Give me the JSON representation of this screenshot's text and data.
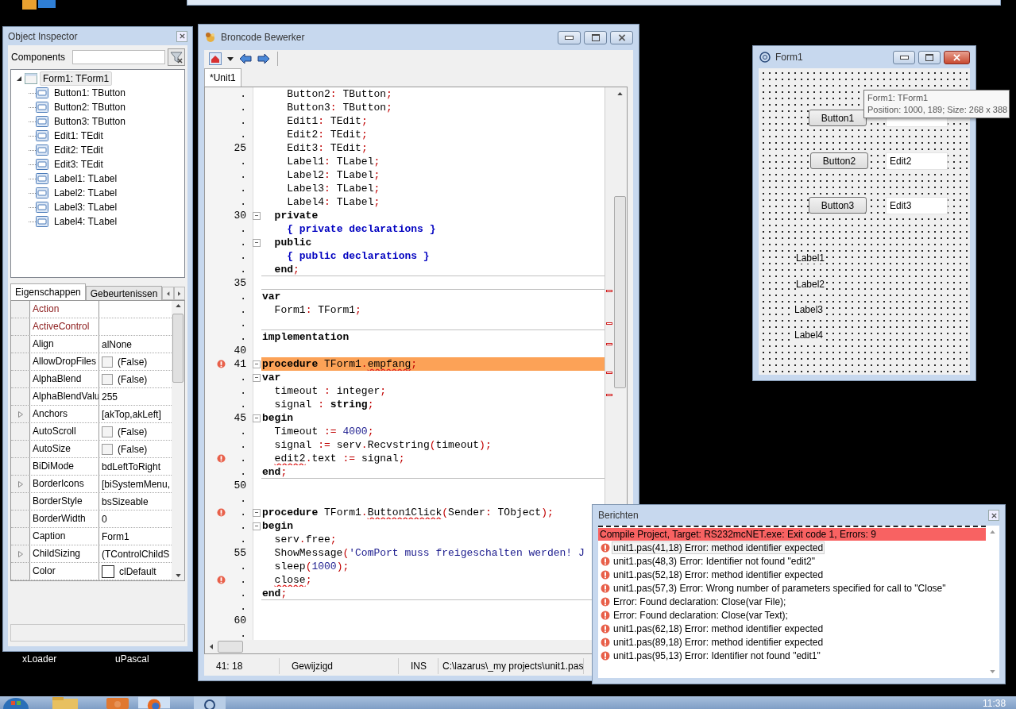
{
  "inspector": {
    "title": "Object Inspector",
    "components_label": "Components",
    "tree": [
      {
        "label": "Form1: TForm1",
        "selected": true,
        "expanded": true,
        "children": [
          {
            "label": "Button1: TButton",
            "selected": false
          },
          {
            "label": "Button2: TButton",
            "selected": false
          },
          {
            "label": "Button3: TButton",
            "selected": false
          },
          {
            "label": "Edit1: TEdit",
            "selected": false
          },
          {
            "label": "Edit2: TEdit",
            "selected": false
          },
          {
            "label": "Edit3: TEdit",
            "selected": false
          },
          {
            "label": "Label1: TLabel",
            "selected": false
          },
          {
            "label": "Label2: TLabel",
            "selected": false
          },
          {
            "label": "Label3: TLabel",
            "selected": false
          },
          {
            "label": "Label4: TLabel",
            "selected": false
          }
        ]
      }
    ],
    "tabs": [
      {
        "label": "Eigenschappen",
        "selected": true
      },
      {
        "label": "Gebeurtenissen",
        "selected": false
      }
    ],
    "properties": [
      {
        "name": "Action",
        "kind": "text",
        "reference": true,
        "expandable": false
      },
      {
        "name": "ActiveControl",
        "kind": "text",
        "reference": true,
        "expandable": false
      },
      {
        "name": "Align",
        "kind": "text",
        "value": "alNone",
        "reference": false,
        "expandable": false
      },
      {
        "name": "AllowDropFiles",
        "kind": "check",
        "checked": false,
        "value": "(False)",
        "reference": false,
        "expandable": false
      },
      {
        "name": "AlphaBlend",
        "kind": "check",
        "checked": false,
        "value": "(False)",
        "reference": false,
        "expandable": false
      },
      {
        "name": "AlphaBlendValu",
        "kind": "text",
        "value": "255",
        "reference": false,
        "expandable": false
      },
      {
        "name": "Anchors",
        "kind": "text",
        "value": "[akTop,akLeft]",
        "reference": false,
        "expandable": true
      },
      {
        "name": "AutoScroll",
        "kind": "check",
        "checked": false,
        "value": "(False)",
        "reference": false,
        "expandable": false
      },
      {
        "name": "AutoSize",
        "kind": "check",
        "checked": false,
        "value": "(False)",
        "reference": false,
        "expandable": false
      },
      {
        "name": "BiDiMode",
        "kind": "text",
        "value": "bdLeftToRight",
        "reference": false,
        "expandable": false
      },
      {
        "name": "BorderIcons",
        "kind": "text",
        "value": "[biSystemMenu,",
        "reference": false,
        "expandable": true
      },
      {
        "name": "BorderStyle",
        "kind": "text",
        "value": "bsSizeable",
        "reference": false,
        "expandable": false
      },
      {
        "name": "BorderWidth",
        "kind": "text",
        "value": "0",
        "reference": false,
        "expandable": false
      },
      {
        "name": "Caption",
        "kind": "text",
        "value": "Form1",
        "reference": false,
        "expandable": false
      },
      {
        "name": "ChildSizing",
        "kind": "text",
        "value": "(TControlChildS",
        "reference": false,
        "expandable": true
      },
      {
        "name": "Color",
        "kind": "color",
        "value": "clDefault",
        "reference": false,
        "expandable": false
      }
    ]
  },
  "editor": {
    "title": "Broncode Bewerker",
    "tabs": [
      {
        "label": "*Unit1",
        "selected": true
      }
    ],
    "lines": [
      {
        "gutter": ".",
        "error": false,
        "fold": false,
        "rule": false,
        "highlighted": false,
        "segments": [
          {
            "kind": "id",
            "text": "    Button2"
          },
          {
            "kind": "sym",
            "text": ":"
          },
          {
            "kind": "id",
            "text": " TButton"
          },
          {
            "kind": "sym",
            "text": ";"
          }
        ]
      },
      {
        "gutter": ".",
        "error": false,
        "fold": false,
        "rule": false,
        "highlighted": false,
        "segments": [
          {
            "kind": "id",
            "text": "    Button3"
          },
          {
            "kind": "sym",
            "text": ":"
          },
          {
            "kind": "id",
            "text": " TButton"
          },
          {
            "kind": "sym",
            "text": ";"
          }
        ]
      },
      {
        "gutter": ".",
        "error": false,
        "fold": false,
        "rule": false,
        "highlighted": false,
        "segments": [
          {
            "kind": "id",
            "text": "    Edit1"
          },
          {
            "kind": "sym",
            "text": ":"
          },
          {
            "kind": "id",
            "text": " TEdit"
          },
          {
            "kind": "sym",
            "text": ";"
          }
        ]
      },
      {
        "gutter": ".",
        "error": false,
        "fold": false,
        "rule": false,
        "highlighted": false,
        "segments": [
          {
            "kind": "id",
            "text": "    Edit2"
          },
          {
            "kind": "sym",
            "text": ":"
          },
          {
            "kind": "id",
            "text": " TEdit"
          },
          {
            "kind": "sym",
            "text": ";"
          }
        ]
      },
      {
        "gutter": "25",
        "error": false,
        "fold": false,
        "rule": false,
        "highlighted": false,
        "segments": [
          {
            "kind": "id",
            "text": "    Edit3"
          },
          {
            "kind": "sym",
            "text": ":"
          },
          {
            "kind": "id",
            "text": " TEdit"
          },
          {
            "kind": "sym",
            "text": ";"
          }
        ]
      },
      {
        "gutter": ".",
        "error": false,
        "fold": false,
        "rule": false,
        "highlighted": false,
        "segments": [
          {
            "kind": "id",
            "text": "    Label1"
          },
          {
            "kind": "sym",
            "text": ":"
          },
          {
            "kind": "id",
            "text": " TLabel"
          },
          {
            "kind": "sym",
            "text": ";"
          }
        ]
      },
      {
        "gutter": ".",
        "error": false,
        "fold": false,
        "rule": false,
        "highlighted": false,
        "segments": [
          {
            "kind": "id",
            "text": "    Label2"
          },
          {
            "kind": "sym",
            "text": ":"
          },
          {
            "kind": "id",
            "text": " TLabel"
          },
          {
            "kind": "sym",
            "text": ";"
          }
        ]
      },
      {
        "gutter": ".",
        "error": false,
        "fold": false,
        "rule": false,
        "highlighted": false,
        "segments": [
          {
            "kind": "id",
            "text": "    Label3"
          },
          {
            "kind": "sym",
            "text": ":"
          },
          {
            "kind": "id",
            "text": " TLabel"
          },
          {
            "kind": "sym",
            "text": ";"
          }
        ]
      },
      {
        "gutter": ".",
        "error": false,
        "fold": false,
        "rule": false,
        "highlighted": false,
        "segments": [
          {
            "kind": "id",
            "text": "    Label4"
          },
          {
            "kind": "sym",
            "text": ":"
          },
          {
            "kind": "id",
            "text": " TLabel"
          },
          {
            "kind": "sym",
            "text": ";"
          }
        ]
      },
      {
        "gutter": "30",
        "error": false,
        "fold": true,
        "rule": false,
        "highlighted": false,
        "segments": [
          {
            "kind": "kw",
            "text": "  private"
          }
        ]
      },
      {
        "gutter": ".",
        "error": false,
        "fold": false,
        "rule": false,
        "highlighted": false,
        "segments": [
          {
            "kind": "com",
            "text": "    { private declarations }"
          }
        ]
      },
      {
        "gutter": ".",
        "error": false,
        "fold": true,
        "rule": false,
        "highlighted": false,
        "segments": [
          {
            "kind": "kw",
            "text": "  public"
          }
        ]
      },
      {
        "gutter": ".",
        "error": false,
        "fold": false,
        "rule": false,
        "highlighted": false,
        "segments": [
          {
            "kind": "com",
            "text": "    { public declarations }"
          }
        ]
      },
      {
        "gutter": ".",
        "error": false,
        "fold": false,
        "rule": true,
        "highlighted": false,
        "segments": [
          {
            "kind": "kw",
            "text": "  end"
          },
          {
            "kind": "sym",
            "text": ";"
          }
        ]
      },
      {
        "gutter": "35",
        "error": false,
        "fold": false,
        "rule": true,
        "highlighted": false
      },
      {
        "gutter": ".",
        "error": false,
        "fold": false,
        "rule": false,
        "highlighted": false,
        "segments": [
          {
            "kind": "kw",
            "text": "var"
          }
        ]
      },
      {
        "gutter": ".",
        "error": false,
        "fold": false,
        "rule": false,
        "highlighted": false,
        "segments": [
          {
            "kind": "id",
            "text": "  Form1"
          },
          {
            "kind": "sym",
            "text": ":"
          },
          {
            "kind": "id",
            "text": " TForm1"
          },
          {
            "kind": "sym",
            "text": ";"
          }
        ]
      },
      {
        "gutter": ".",
        "error": false,
        "fold": false,
        "rule": true,
        "highlighted": false
      },
      {
        "gutter": ".",
        "error": false,
        "fold": false,
        "rule": false,
        "highlighted": false,
        "segments": [
          {
            "kind": "kw",
            "text": "implementation"
          }
        ]
      },
      {
        "gutter": "40",
        "error": false,
        "fold": false,
        "rule": false,
        "highlighted": false
      },
      {
        "gutter": "41",
        "error": true,
        "fold": true,
        "rule": false,
        "highlighted": true,
        "segments": [
          {
            "kind": "kw",
            "text": "procedure"
          },
          {
            "kind": "id",
            "text": " TForm1"
          },
          {
            "kind": "sym",
            "text": "."
          },
          {
            "kind": "id",
            "text": "empfang",
            "squiggle": true
          },
          {
            "kind": "sym",
            "text": ";"
          }
        ]
      },
      {
        "gutter": ".",
        "error": false,
        "fold": true,
        "rule": false,
        "highlighted": false,
        "segments": [
          {
            "kind": "kw",
            "text": "var"
          }
        ]
      },
      {
        "gutter": ".",
        "error": false,
        "fold": false,
        "rule": false,
        "highlighted": false,
        "segments": [
          {
            "kind": "id",
            "text": "  timeout "
          },
          {
            "kind": "sym",
            "text": ":"
          },
          {
            "kind": "id",
            "text": " integer"
          },
          {
            "kind": "sym",
            "text": ";"
          }
        ]
      },
      {
        "gutter": ".",
        "error": false,
        "fold": false,
        "rule": false,
        "highlighted": false,
        "segments": [
          {
            "kind": "id",
            "text": "  signal "
          },
          {
            "kind": "sym",
            "text": ":"
          },
          {
            "kind": "kw",
            "text": " string"
          },
          {
            "kind": "sym",
            "text": ";"
          }
        ]
      },
      {
        "gutter": "45",
        "error": false,
        "fold": true,
        "rule": false,
        "highlighted": false,
        "segments": [
          {
            "kind": "kw",
            "text": "begin"
          }
        ]
      },
      {
        "gutter": ".",
        "error": false,
        "fold": false,
        "rule": false,
        "highlighted": false,
        "segments": [
          {
            "kind": "id",
            "text": "  Timeout "
          },
          {
            "kind": "sym",
            "text": ":="
          },
          {
            "kind": "num",
            "text": " 4000"
          },
          {
            "kind": "sym",
            "text": ";"
          }
        ]
      },
      {
        "gutter": ".",
        "error": false,
        "fold": false,
        "rule": false,
        "highlighted": false,
        "segments": [
          {
            "kind": "id",
            "text": "  signal "
          },
          {
            "kind": "sym",
            "text": ":="
          },
          {
            "kind": "id",
            "text": " serv"
          },
          {
            "kind": "sym",
            "text": "."
          },
          {
            "kind": "id",
            "text": "Recvstring"
          },
          {
            "kind": "sym",
            "text": "("
          },
          {
            "kind": "id",
            "text": "timeout"
          },
          {
            "kind": "sym",
            "text": ");"
          }
        ]
      },
      {
        "gutter": ".",
        "error": true,
        "fold": false,
        "rule": false,
        "highlighted": false,
        "segments": [
          {
            "kind": "id",
            "text": "  edit2",
            "squiggle": true
          },
          {
            "kind": "sym",
            "text": "."
          },
          {
            "kind": "id",
            "text": "text "
          },
          {
            "kind": "sym",
            "text": ":="
          },
          {
            "kind": "id",
            "text": " signal"
          },
          {
            "kind": "sym",
            "text": ";"
          }
        ]
      },
      {
        "gutter": ".",
        "error": false,
        "fold": false,
        "rule": true,
        "highlighted": false,
        "segments": [
          {
            "kind": "kw",
            "text": "end"
          },
          {
            "kind": "sym",
            "text": ";"
          }
        ]
      },
      {
        "gutter": "50",
        "error": false,
        "fold": false,
        "rule": false,
        "highlighted": false
      },
      {
        "gutter": ".",
        "error": false,
        "fold": false,
        "rule": false,
        "highlighted": false
      },
      {
        "gutter": ".",
        "error": true,
        "fold": true,
        "rule": false,
        "highlighted": false,
        "segments": [
          {
            "kind": "kw",
            "text": "procedure"
          },
          {
            "kind": "id",
            "text": " TForm1"
          },
          {
            "kind": "sym",
            "text": "."
          },
          {
            "kind": "id",
            "text": "Button1Click",
            "squiggle": true
          },
          {
            "kind": "sym",
            "text": "("
          },
          {
            "kind": "id",
            "text": "Sender"
          },
          {
            "kind": "sym",
            "text": ":"
          },
          {
            "kind": "id",
            "text": " TObject"
          },
          {
            "kind": "sym",
            "text": ");"
          }
        ]
      },
      {
        "gutter": ".",
        "error": false,
        "fold": true,
        "rule": false,
        "highlighted": false,
        "segments": [
          {
            "kind": "kw",
            "text": "begin"
          }
        ]
      },
      {
        "gutter": ".",
        "error": false,
        "fold": false,
        "rule": false,
        "highlighted": false,
        "segments": [
          {
            "kind": "id",
            "text": "  serv"
          },
          {
            "kind": "sym",
            "text": "."
          },
          {
            "kind": "id",
            "text": "free"
          },
          {
            "kind": "sym",
            "text": ";"
          }
        ]
      },
      {
        "gutter": "55",
        "error": false,
        "fold": false,
        "rule": false,
        "highlighted": false,
        "segments": [
          {
            "kind": "id",
            "text": "  ShowMessage"
          },
          {
            "kind": "sym",
            "text": "("
          },
          {
            "kind": "str",
            "text": "'ComPort muss freigeschalten werden! J"
          }
        ]
      },
      {
        "gutter": ".",
        "error": false,
        "fold": false,
        "rule": false,
        "highlighted": false,
        "segments": [
          {
            "kind": "id",
            "text": "  sleep"
          },
          {
            "kind": "sym",
            "text": "("
          },
          {
            "kind": "num",
            "text": "1000"
          },
          {
            "kind": "sym",
            "text": ");"
          }
        ]
      },
      {
        "gutter": ".",
        "error": true,
        "fold": false,
        "rule": false,
        "highlighted": false,
        "segments": [
          {
            "kind": "id",
            "text": "  close",
            "squiggle": true
          },
          {
            "kind": "sym",
            "text": ";"
          }
        ]
      },
      {
        "gutter": ".",
        "error": false,
        "fold": false,
        "rule": true,
        "highlighted": false,
        "segments": [
          {
            "kind": "kw",
            "text": "end"
          },
          {
            "kind": "sym",
            "text": ";"
          }
        ]
      },
      {
        "gutter": ".",
        "error": false,
        "fold": false,
        "rule": false,
        "highlighted": false
      },
      {
        "gutter": "60",
        "error": false,
        "fold": false,
        "rule": false,
        "highlighted": false
      },
      {
        "gutter": ".",
        "error": false,
        "fold": false,
        "rule": false,
        "highlighted": false
      }
    ],
    "status": [
      "41: 18",
      "Gewijzigd",
      "INS",
      "C:\\lazarus\\_my projects\\unit1.pas"
    ]
  },
  "form": {
    "title": "Form1",
    "buttons": [
      "Button1",
      "Button2",
      "Button3"
    ],
    "edits": [
      {
        "kind": "covered"
      },
      {
        "kind": "text",
        "value": "Edit2"
      },
      {
        "kind": "text",
        "value": "Edit3"
      }
    ],
    "labels": [
      "Label1",
      "Label2",
      "Label3",
      "Label4"
    ],
    "tooltip": [
      "Form1: TForm1",
      "Position: 1000, 189; Size: 268 x 388"
    ]
  },
  "messages": {
    "title": "Berichten",
    "items": [
      {
        "kind": "summary",
        "text": "Compile Project, Target: RS232mcNET.exe: Exit code 1, Errors: 9",
        "selected": false
      },
      {
        "kind": "error",
        "text": "unit1.pas(41,18) Error: method identifier expected",
        "selected": true
      },
      {
        "kind": "error",
        "text": "unit1.pas(48,3) Error: Identifier not found \"edit2\"",
        "selected": false
      },
      {
        "kind": "error",
        "text": "unit1.pas(52,18) Error: method identifier expected",
        "selected": false
      },
      {
        "kind": "error",
        "text": "unit1.pas(57,3) Error: Wrong number of parameters specified for call to \"Close\"",
        "selected": false
      },
      {
        "kind": "error",
        "text": "Error: Found declaration: Close(var File);",
        "selected": false
      },
      {
        "kind": "error",
        "text": "Error: Found declaration: Close(var Text);",
        "selected": false
      },
      {
        "kind": "error",
        "text": "unit1.pas(62,18) Error: method identifier expected",
        "selected": false
      },
      {
        "kind": "error",
        "text": "unit1.pas(89,18) Error: method identifier expected",
        "selected": false
      },
      {
        "kind": "error",
        "text": "unit1.pas(95,13) Error: Identifier not found \"edit1\"",
        "selected": false
      }
    ]
  },
  "desktop": {
    "icons": [
      "xLoader",
      "uPascal"
    ]
  },
  "taskbar": {
    "clock": "11:38"
  }
}
